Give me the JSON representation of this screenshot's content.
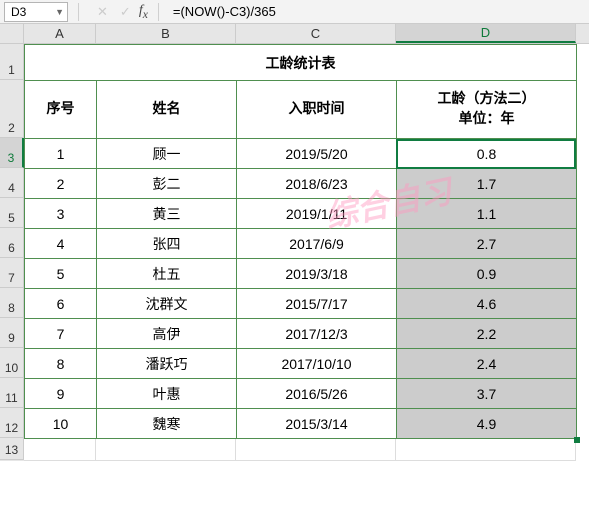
{
  "name_box": "D3",
  "formula": "=(NOW()-C3)/365",
  "columns": [
    "A",
    "B",
    "C",
    "D"
  ],
  "row_numbers": [
    "1",
    "2",
    "3",
    "4",
    "5",
    "6",
    "7",
    "8",
    "9",
    "10",
    "11",
    "12",
    "13"
  ],
  "title": "工龄统计表",
  "headers": {
    "seq": "序号",
    "name": "姓名",
    "hire": "入职时间",
    "tenure_l1": "工龄（方法二）",
    "tenure_l2": "单位：年"
  },
  "rows": [
    {
      "seq": "1",
      "name": "顾一",
      "hire": "2019/5/20",
      "tenure": "0.8"
    },
    {
      "seq": "2",
      "name": "彭二",
      "hire": "2018/6/23",
      "tenure": "1.7"
    },
    {
      "seq": "3",
      "name": "黄三",
      "hire": "2019/1/11",
      "tenure": "1.1"
    },
    {
      "seq": "4",
      "name": "张四",
      "hire": "2017/6/9",
      "tenure": "2.7"
    },
    {
      "seq": "5",
      "name": "杜五",
      "hire": "2019/3/18",
      "tenure": "0.9"
    },
    {
      "seq": "6",
      "name": "沈群文",
      "hire": "2015/7/17",
      "tenure": "4.6"
    },
    {
      "seq": "7",
      "name": "高伊",
      "hire": "2017/12/3",
      "tenure": "2.2"
    },
    {
      "seq": "8",
      "name": "潘跃巧",
      "hire": "2017/10/10",
      "tenure": "2.4"
    },
    {
      "seq": "9",
      "name": "叶惠",
      "hire": "2016/5/26",
      "tenure": "3.7"
    },
    {
      "seq": "10",
      "name": "魏寒",
      "hire": "2015/3/14",
      "tenure": "4.9"
    }
  ],
  "watermark": "综合自习",
  "active_cell": {
    "col": "D",
    "row": 3
  }
}
